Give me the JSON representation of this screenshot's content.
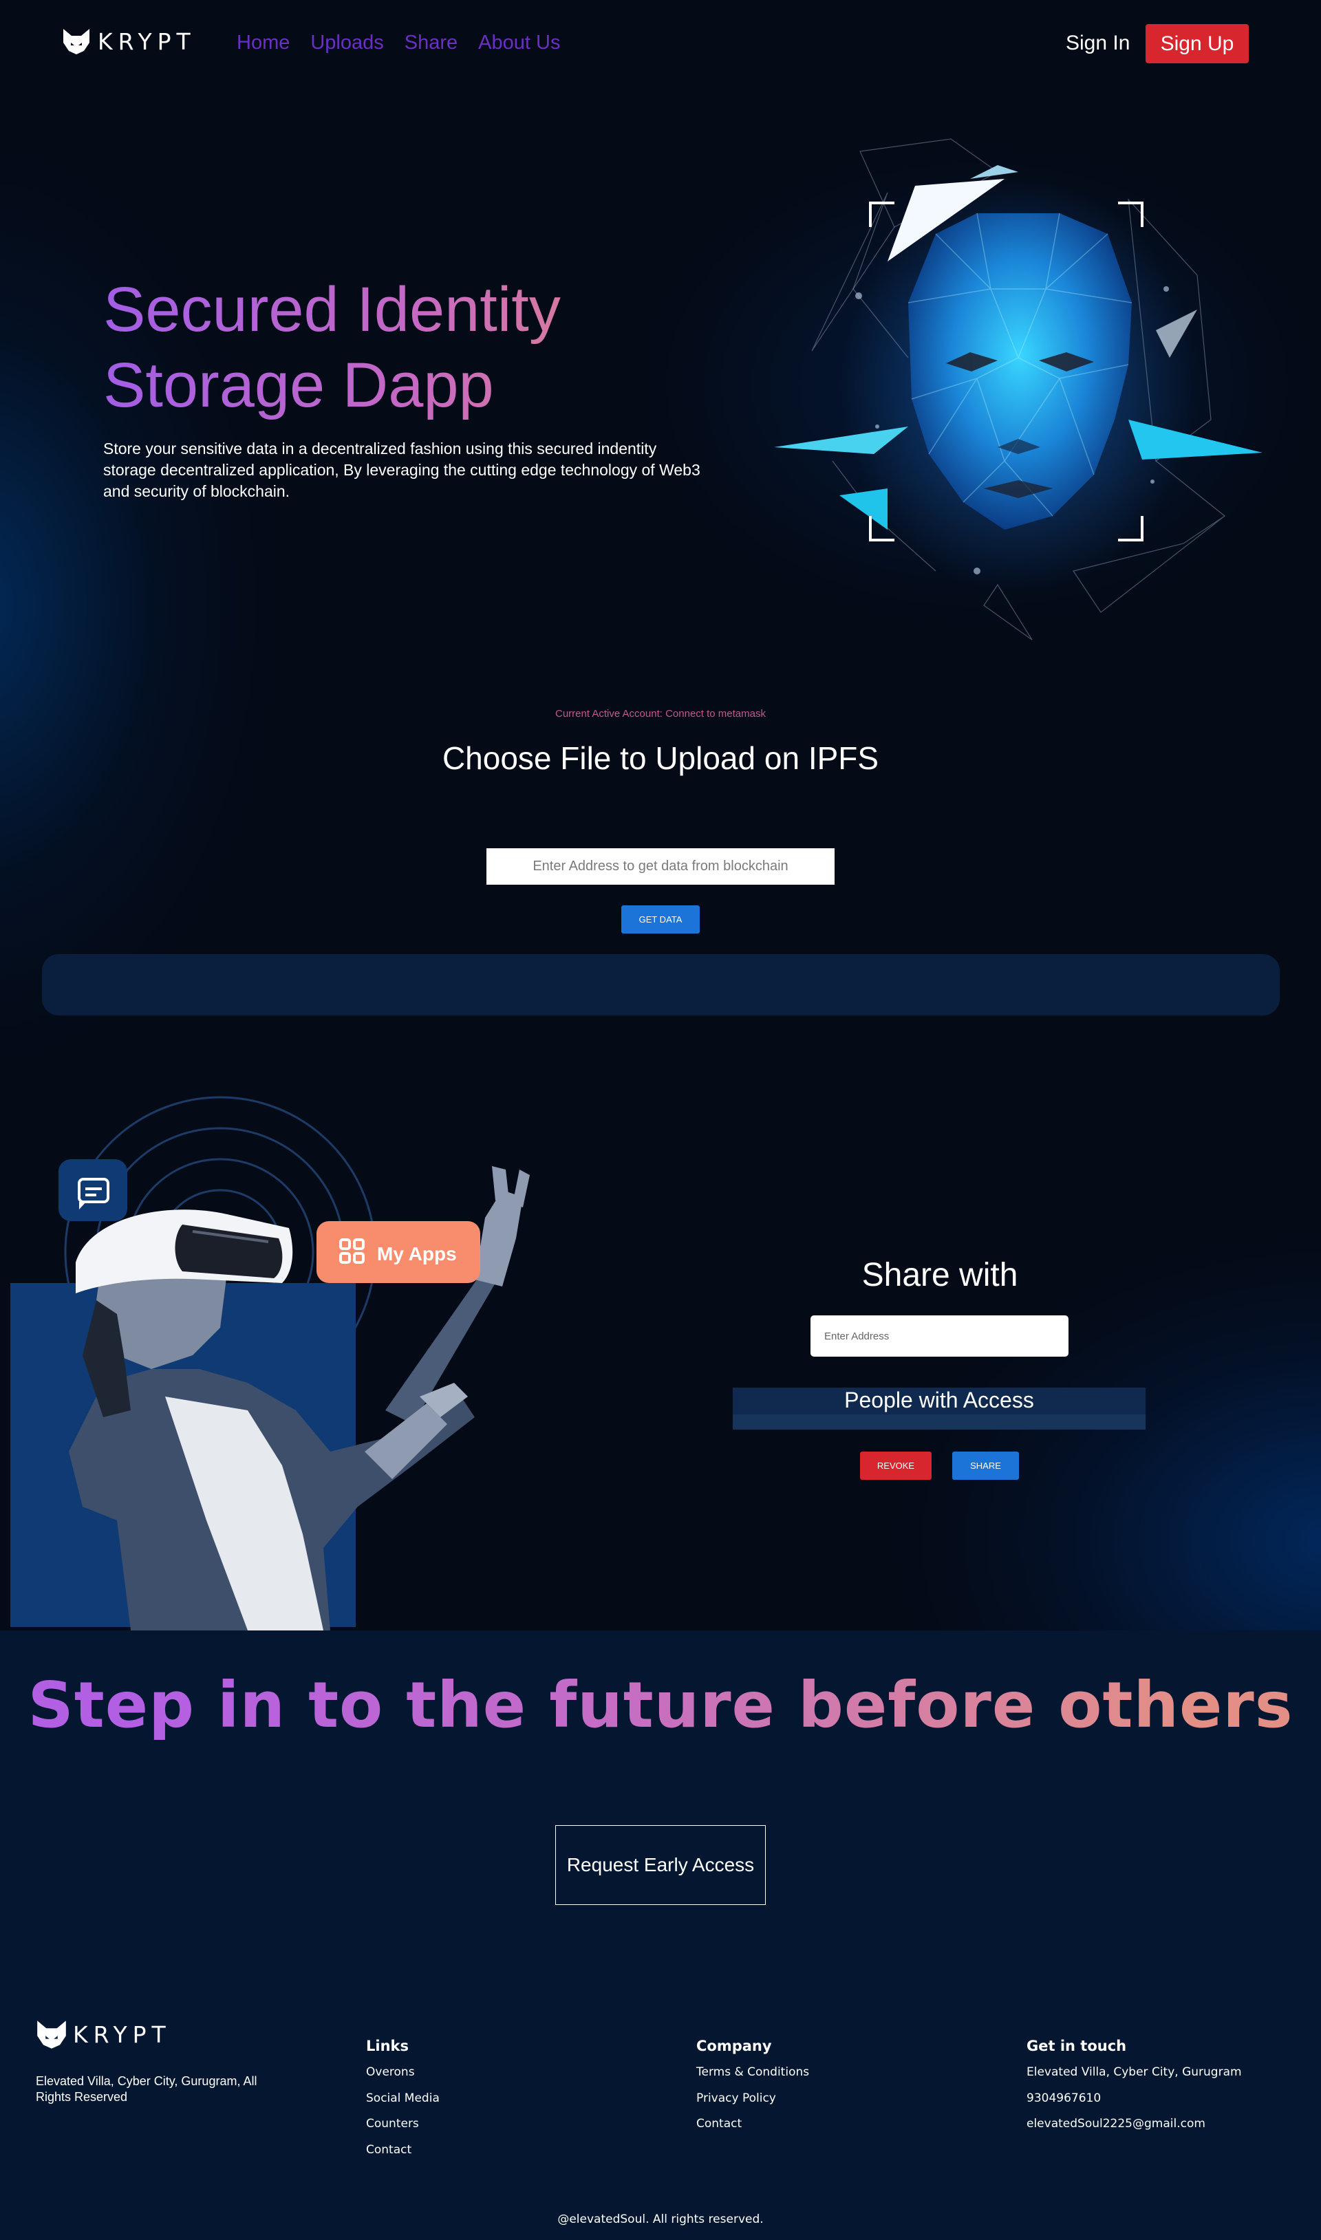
{
  "brand": {
    "name": "KRYPT"
  },
  "nav": {
    "links": [
      "Home",
      "Uploads",
      "Share",
      "About Us"
    ],
    "signin": "Sign In",
    "signup": "Sign Up"
  },
  "hero": {
    "title": "Secured Identity Storage Dapp",
    "description": "Store your sensitive data in a decentralized fashion using this secured indentity storage decentralized application, By leveraging the cutting edge technology of Web3 and security of blockchain."
  },
  "upload": {
    "account_line": "Current Active Account: Connect to metamask",
    "title": "Choose File to Upload on IPFS",
    "address_placeholder": "Enter Address to get data from blockchain",
    "get_data_label": "GET DATA"
  },
  "illustration": {
    "apps_label": "My Apps"
  },
  "share": {
    "title": "Share with",
    "input_placeholder": "Enter Address",
    "access_title": "People with Access",
    "revoke_label": "REVOKE",
    "share_label": "SHARE"
  },
  "cta": {
    "title": "Step in to the future before others",
    "button_label": "Request Early Access"
  },
  "footer": {
    "address": "Elevated Villa, Cyber City, Gurugram, All Rights Reserved",
    "columns": [
      {
        "heading": "Links",
        "items": [
          "Overons",
          "Social Media",
          "Counters",
          "Contact"
        ]
      },
      {
        "heading": "Company",
        "items": [
          "Terms & Conditions",
          "Privacy Policy",
          "Contact"
        ]
      },
      {
        "heading": "Get in touch",
        "items": [
          "Elevated Villa, Cyber City, Gurugram",
          "9304967610",
          "elevatedSoul2225@gmail.com"
        ]
      }
    ],
    "copyright": "@elevatedSoul. All rights reserved."
  },
  "colors": {
    "background": "#040a16",
    "nav_link": "#6b2fc6",
    "signup": "#d8262f",
    "button_blue": "#1c74d8",
    "panel": "#0a1f3e",
    "apps_badge": "#f88d6d",
    "cta_band": "#041630"
  }
}
